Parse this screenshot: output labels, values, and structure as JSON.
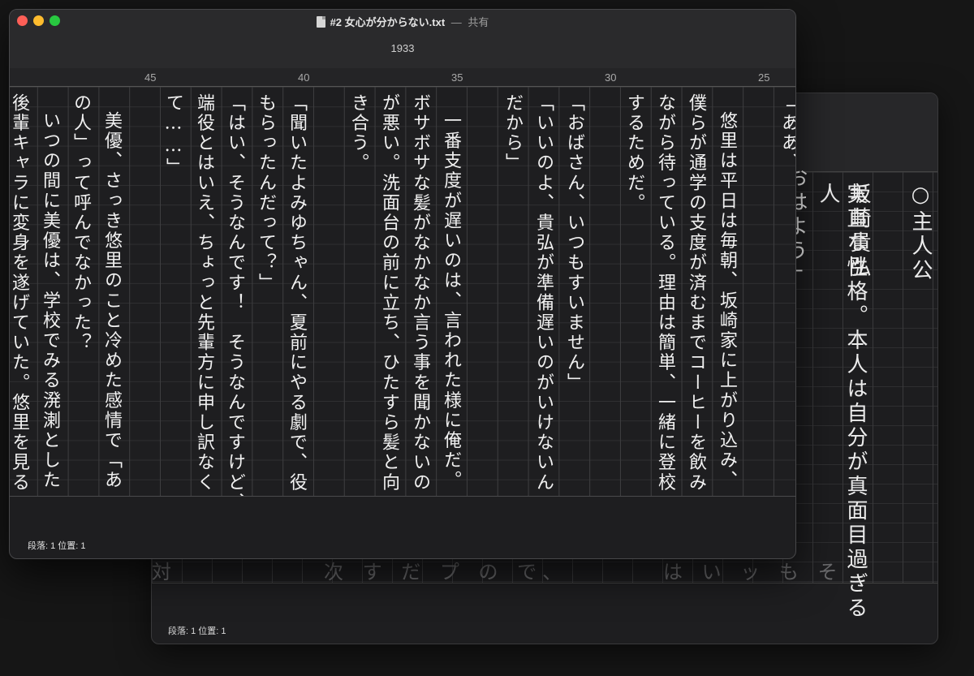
{
  "back_window": {
    "columns": [
      "○主人公",
      "坂崎貴弘",
      "実直な性格。本人は自分が真面目過ぎる人",
      "おはよう」"
    ],
    "bottom_row": "は い ッ も そ",
    "bottom_row_left": "次 す だ プ の で、",
    "bottom_row_far": "対",
    "status": "段落: 1  位置: 1"
  },
  "front_window": {
    "title": "#2 女心が分からない.txt",
    "title_separator": "—",
    "shared_label": "共有",
    "char_count": "1933",
    "ruler": [
      "25",
      "30",
      "35",
      "40",
      "45"
    ],
    "columns": [
      "「ああ、",
      "悠里は平日は毎朝、坂崎家に上がり込み、",
      "僕らが通学の支度が済むまでコーヒーを飲み",
      "ながら待っている。理由は簡単、一緒に登校",
      "するためだ。",
      "「おばさん、いつもすいません」",
      "「いいのよ、貴弘が準備遅いのがいけないん",
      "だから」",
      "一番支度が遅いのは、言われた様に俺だ。",
      "ボサボサな髪がなかなか言う事を聞かないの",
      "が悪い。洗面台の前に立ち、ひたすら髪と向",
      "き合う。",
      "「聞いたよみゆちゃん、夏前にやる劇で、役",
      "もらったんだって？」",
      "「はい、そうなんです！　そうなんですけど、",
      "端役とはいえ、ちょっと先輩方に申し訳なく",
      "て……」",
      "美優、さっき悠里のこと冷めた感情で「あ",
      "の人」って呼んでなかった？",
      "いつの間に美優は、学校でみる溌溂とした",
      "後輩キャラに変身を遂げていた。悠里を見る"
    ],
    "status": "段落: 1  位置: 1"
  }
}
